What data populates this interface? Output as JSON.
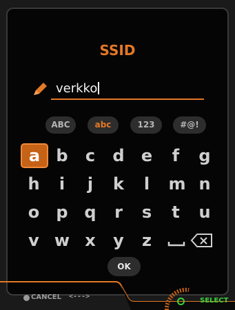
{
  "title": "SSID",
  "input": {
    "value": "verkko",
    "icon": "pencil-icon"
  },
  "modes": [
    {
      "label": "ABC",
      "active": false
    },
    {
      "label": "abc",
      "active": true
    },
    {
      "label": "123",
      "active": false
    },
    {
      "label": "#@!",
      "active": false
    }
  ],
  "keys": {
    "row1": [
      "a",
      "b",
      "c",
      "d",
      "e",
      "f",
      "g"
    ],
    "row2": [
      "h",
      "i",
      "j",
      "k",
      "l",
      "m",
      "n"
    ],
    "row3": [
      "o",
      "p",
      "q",
      "r",
      "s",
      "t",
      "u"
    ],
    "row4": [
      "v",
      "w",
      "x",
      "y",
      "z"
    ],
    "selected": "a",
    "space_icon": "space-bar-icon",
    "backspace_icon": "backspace-icon"
  },
  "ok_label": "OK",
  "footer": {
    "cancel_label": "CANCEL",
    "nav_hint": "<--->",
    "select_label": "SELECT"
  },
  "colors": {
    "accent": "#e47826",
    "select": "#3ad23a",
    "key_text": "#cfcfcf",
    "background": "#050505"
  }
}
